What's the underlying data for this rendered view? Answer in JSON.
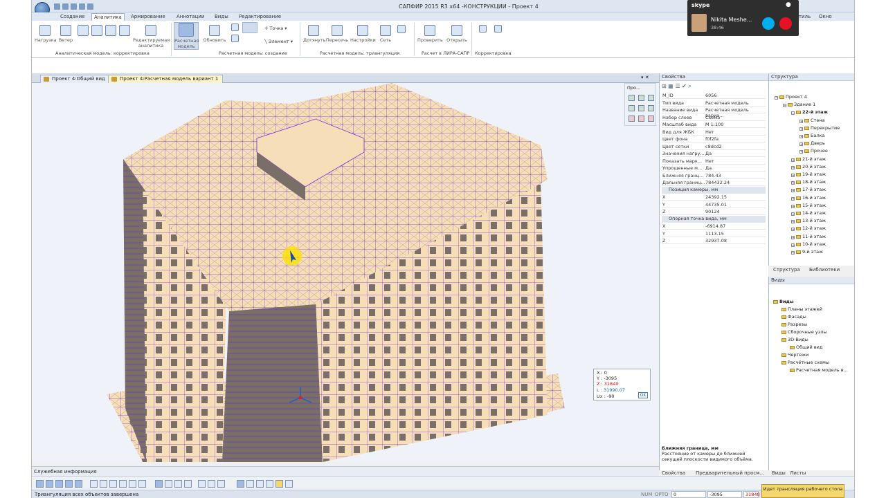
{
  "window": {
    "title": "САПФИР 2015 R3 x64 -КОНСТРУКЦИИ - Проект 4"
  },
  "tabs": [
    "Создание",
    "Аналитика",
    "Армирование",
    "Аннотации",
    "Виды",
    "Редактирование"
  ],
  "active_tab": "Аналитика",
  "top_right": {
    "style_label": "Стиль",
    "window_label": "Окно"
  },
  "ribbon": {
    "groups": [
      {
        "label": "Аналитическая модель: корректировка",
        "buttons": [
          "Нагрузка",
          "Ветер",
          "Редактируемая аналитика"
        ]
      },
      {
        "label": "Расчетная модель: создание",
        "buttons": [
          "Расчетная модель",
          "Обновить",
          "Точка",
          "Элемент"
        ]
      },
      {
        "label": "Расчетная модель: триангуляция",
        "buttons": [
          "Дотянуть",
          "Пересечь",
          "Настройки",
          "Сеть"
        ]
      },
      {
        "label": "Расчет в ЛИРА-САПР",
        "buttons": [
          "Проверить",
          "Открыть"
        ]
      },
      {
        "label": "Корректировка",
        "buttons": []
      }
    ]
  },
  "doc_tabs": [
    "Проект 4:Общий вид",
    "Проект 4:Расчетная модель вариант 1"
  ],
  "view_panel": {
    "label": "Про..."
  },
  "coords": {
    "x_label": "X",
    "x_val": "0",
    "y_label": "Y",
    "y_val": "-3095",
    "z_label": "Z",
    "z_val": "31840",
    "l_label": "L",
    "l_val": "31990.07",
    "ux_label": "Ux",
    "ux_val": "-90",
    "ok_label": "OK"
  },
  "properties": {
    "header": "Свойства",
    "rows": [
      {
        "k": "M_ID",
        "v": "6056"
      },
      {
        "k": "Тип вида",
        "v": "Расчетная модель"
      },
      {
        "k": "Название вида",
        "v": "Расчетная модель вариа..."
      },
      {
        "k": "Набор слоев",
        "v": "Схема"
      },
      {
        "k": "Масштаб вида",
        "v": "М 1:100"
      },
      {
        "k": "Вид для ЖБК",
        "v": "Нет"
      },
      {
        "k": "Цвет фона",
        "v": "f0f2fa"
      },
      {
        "k": "Цвет сетки",
        "v": "c8dcd2"
      },
      {
        "k": "Значения нагру...",
        "v": "Да"
      },
      {
        "k": "Показать марк...",
        "v": "Нет"
      },
      {
        "k": "Упрощенные м...",
        "v": "Да"
      },
      {
        "k": "Ближняя гранц...",
        "v": "784.43"
      },
      {
        "k": "Дальняя границ...",
        "v": "784432.24"
      }
    ],
    "sec1": "Позиция камеры, мм",
    "cam": [
      {
        "k": "X",
        "v": "24392.15"
      },
      {
        "k": "Y",
        "v": "44735.01"
      },
      {
        "k": "Z",
        "v": "90124"
      }
    ],
    "sec2": "Опорная точка вида, мм",
    "ref": [
      {
        "k": "X",
        "v": "-6914.87"
      },
      {
        "k": "Y",
        "v": "1113.15"
      },
      {
        "k": "Z",
        "v": "32937.08"
      }
    ],
    "desc_title": "Ближняя граница, мм",
    "desc_text": "Расстояние от камеры до ближней секущей плоскости видимого объёма."
  },
  "bottom_tabs_props": [
    "Свойства",
    "Предварительный просм..."
  ],
  "structure": {
    "header": "Структура",
    "items": [
      "Проект 4",
      "Здание 1",
      "22-й этаж",
      "Стена",
      "Перекрытие",
      "Балка",
      "Дверь",
      "Прочее",
      "21-й этаж",
      "20-й этаж",
      "19-й этаж",
      "18-й этаж",
      "17-й этаж",
      "16-й этаж",
      "15-й этаж",
      "14-й этаж",
      "13-й этаж",
      "12-й этаж",
      "11-й этаж",
      "10-й этаж",
      "9-й этаж"
    ],
    "tabs": [
      "Структура",
      "Библиотеки"
    ]
  },
  "views": {
    "header": "Виды",
    "items": [
      "Виды",
      "Планы этажей",
      "Фасады",
      "Разрезы",
      "Сборочные узлы",
      "3D-Виды",
      "Общий вид",
      "Чертежи",
      "Расчётные схемы",
      "Расчетная модель в..."
    ],
    "tabs": [
      "Виды",
      "Листы"
    ]
  },
  "service_info": "Служебная информация",
  "status": {
    "message": "Триангуляция всех объектов завершена",
    "num": "NUM",
    "orto": "ОРТО",
    "f1": "0",
    "f2": "-3095",
    "f3": "31840"
  },
  "broadcast": "Идет трансляция рабочего стола",
  "skype": {
    "brand": "skype",
    "name": "Nikita Meshe...",
    "time": "38:46"
  },
  "colors": {
    "mesh": "#7b2fe0",
    "slab": "#f5deb8",
    "wall": "#7a6e68",
    "bg": "#f0f2fa"
  }
}
